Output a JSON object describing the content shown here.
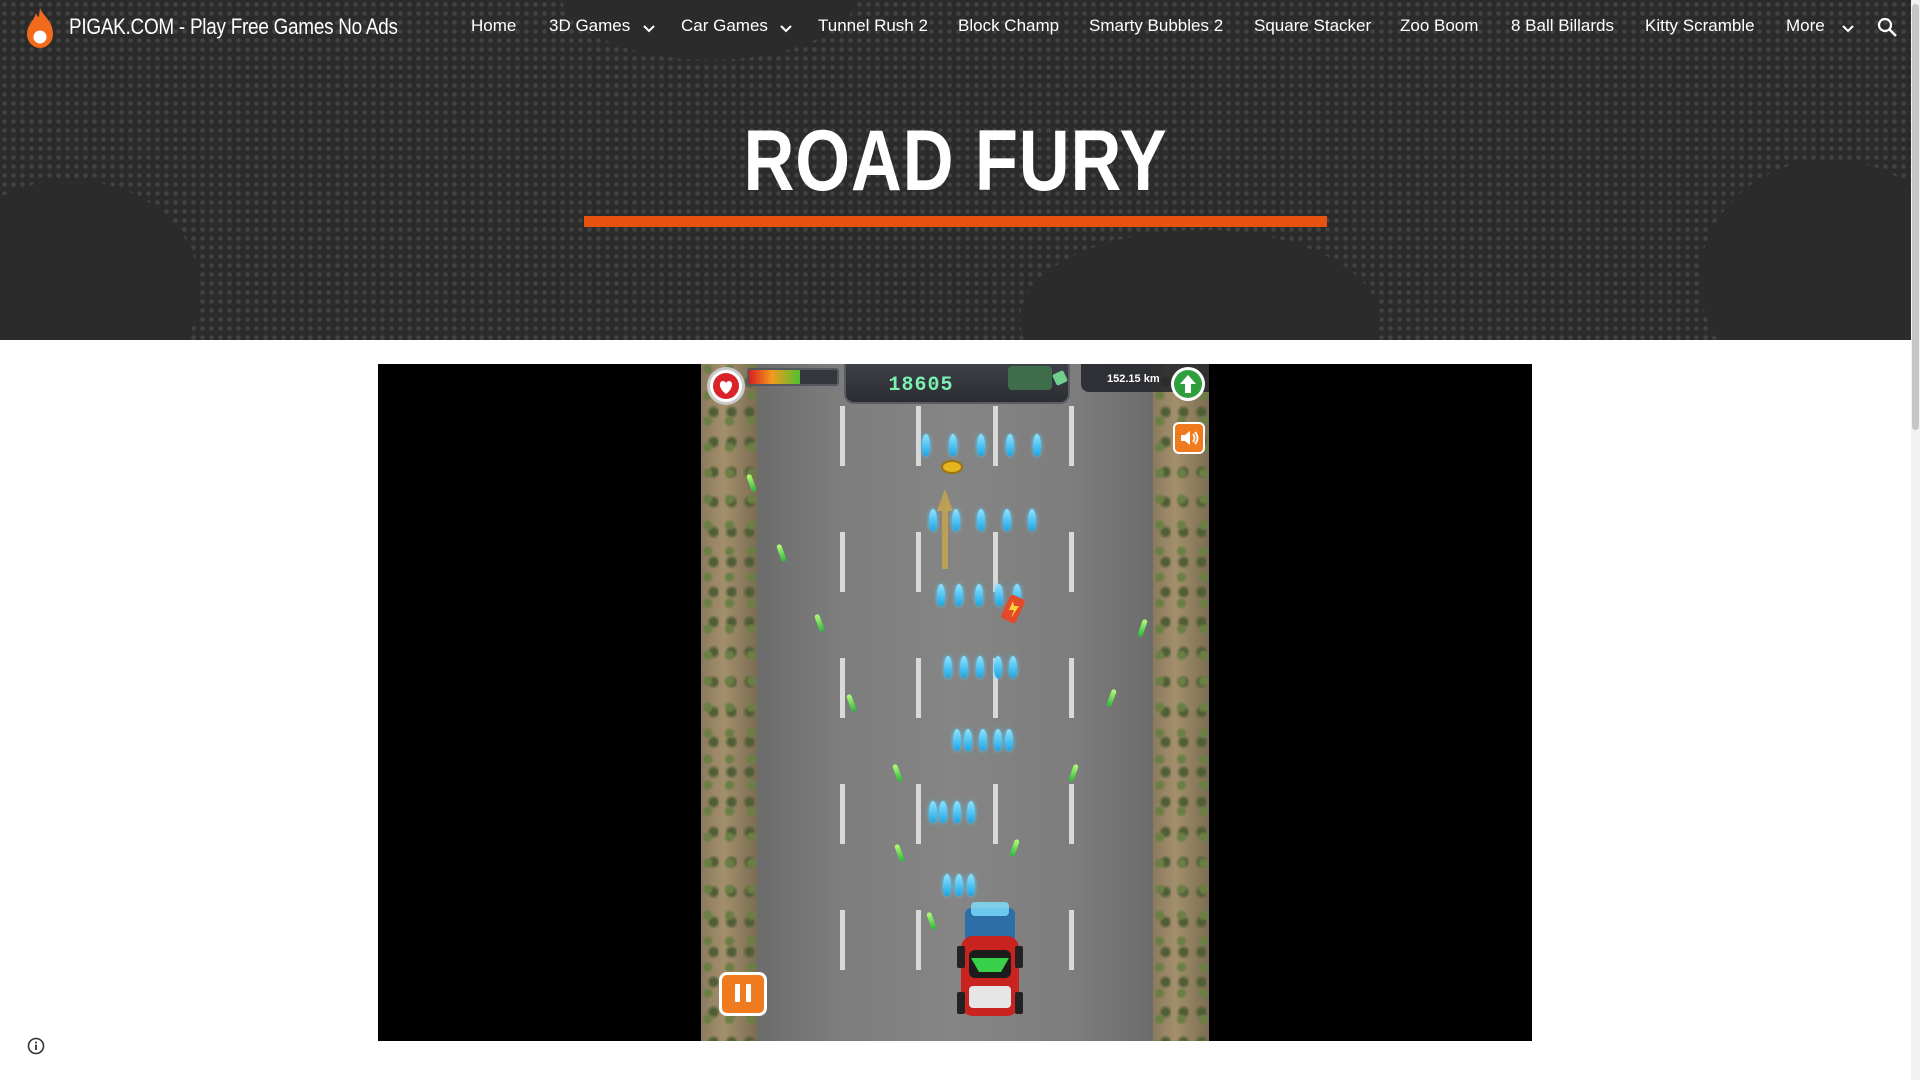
{
  "site": {
    "title": "PIGAK.COM - Play Free Games No Ads",
    "logo_icon": "flame-logo-icon"
  },
  "nav": {
    "items": [
      {
        "label": "Home",
        "has_dropdown": false
      },
      {
        "label": "3D Games",
        "has_dropdown": true
      },
      {
        "label": "Car Games",
        "has_dropdown": true
      },
      {
        "label": "Tunnel Rush 2",
        "has_dropdown": false
      },
      {
        "label": "Block Champ",
        "has_dropdown": false
      },
      {
        "label": "Smarty Bubbles 2",
        "has_dropdown": false
      },
      {
        "label": "Square Stacker",
        "has_dropdown": false
      },
      {
        "label": "Zoo Boom",
        "has_dropdown": false
      },
      {
        "label": "8 Ball Billards",
        "has_dropdown": false
      },
      {
        "label": "Kitty Scramble",
        "has_dropdown": false
      },
      {
        "label": "More",
        "has_dropdown": true
      }
    ],
    "search_icon": "search-icon"
  },
  "page": {
    "title": "ROAD FURY",
    "accent_color": "#e8530f"
  },
  "game": {
    "score": "18605",
    "distance": "152.15  km",
    "health_fraction": 0.58,
    "buttons": {
      "life": "heart-icon",
      "boost": "arrow-up-icon",
      "sound": "speaker-icon",
      "pause": "pause-icon"
    }
  },
  "footer": {
    "info_icon": "info-icon"
  }
}
